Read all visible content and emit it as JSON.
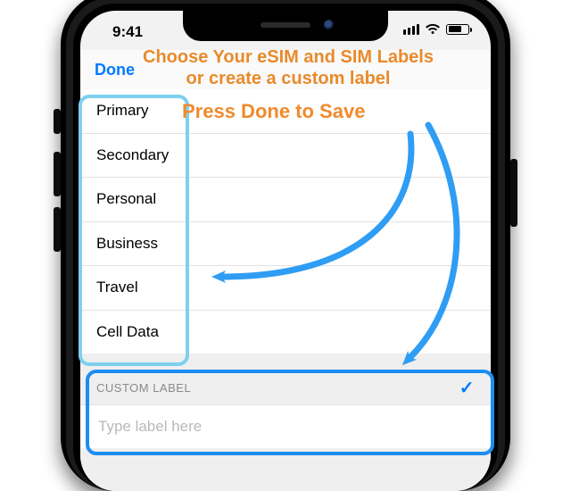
{
  "status": {
    "time": "9:41"
  },
  "nav": {
    "done": "Done"
  },
  "labels": {
    "items": [
      "Primary",
      "Secondary",
      "Personal",
      "Business",
      "Travel",
      "Cell Data"
    ]
  },
  "custom": {
    "header": "CUSTOM LABEL",
    "placeholder": "Type label here",
    "value": ""
  },
  "annotations": {
    "line1": "Choose Your eSIM and SIM Labels",
    "line2": "or create a custom label",
    "press": "Press Done to Save"
  }
}
